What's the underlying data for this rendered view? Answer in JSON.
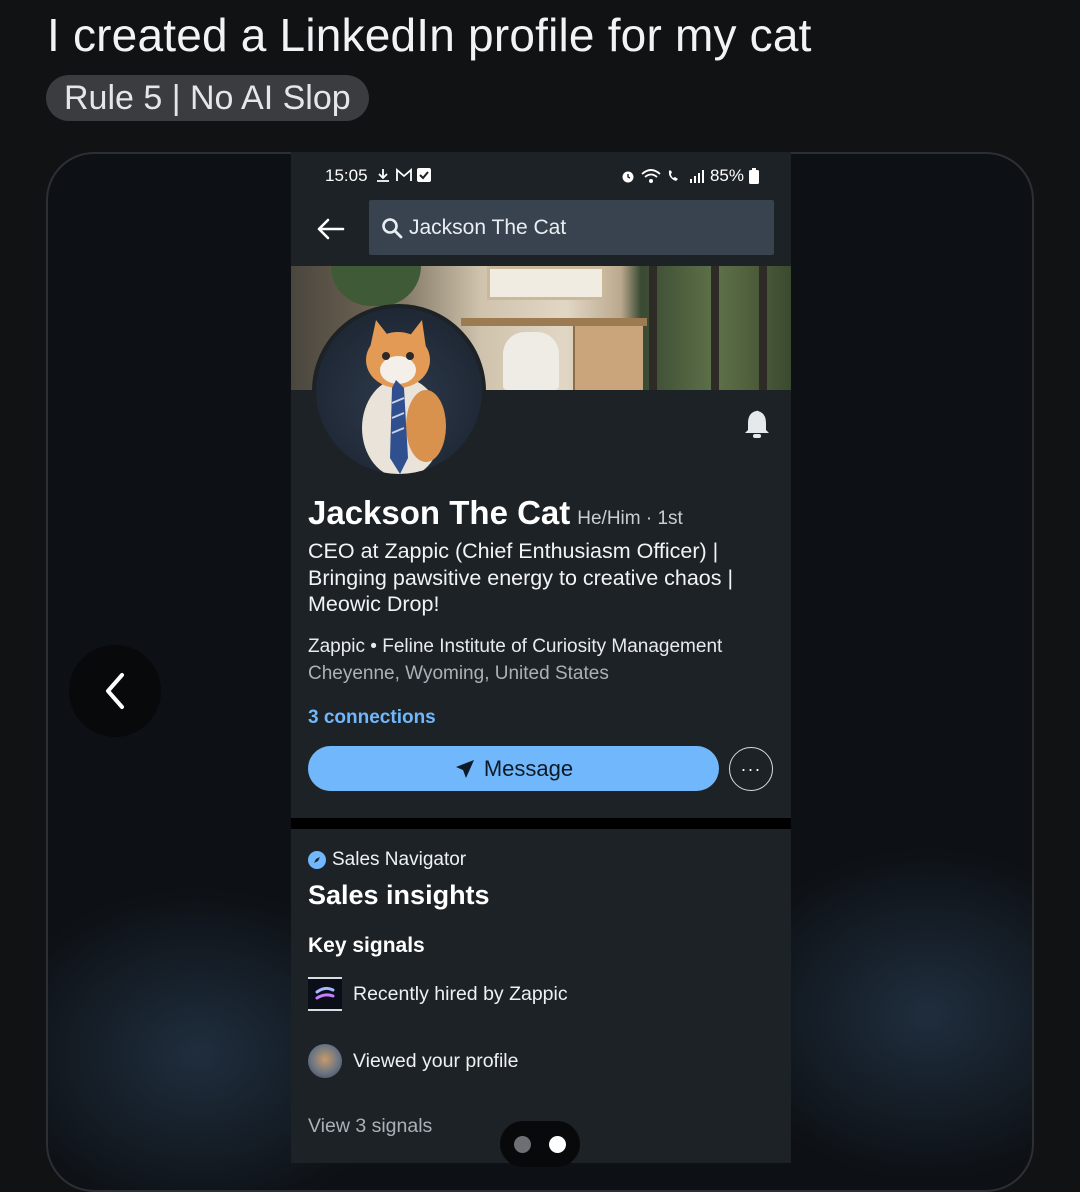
{
  "post": {
    "title": "I created a LinkedIn profile for my cat",
    "flair": "Rule 5 | No AI Slop"
  },
  "status_bar": {
    "time": "15:05",
    "battery": "85%",
    "left_icons": [
      "download-icon",
      "gmail-icon",
      "checkbox-icon"
    ],
    "right_icons": [
      "alarm-icon",
      "wifi-icon",
      "wifi-calling-icon",
      "signal-bars-icon",
      "battery-icon"
    ]
  },
  "search": {
    "query": "Jackson The Cat"
  },
  "profile": {
    "name": "Jackson The Cat",
    "meta": "He/Him · 1st",
    "headline": "CEO at Zappic (Chief Enthusiasm Officer) | Bringing pawsitive energy to creative chaos | Meowic Drop!",
    "org_line": "Zappic • Feline Institute of Curiosity Management",
    "location": "Cheyenne, Wyoming, United States",
    "connections": "3 connections",
    "message_label": "Message",
    "more_label": "···"
  },
  "sales": {
    "navigator_label": "Sales Navigator",
    "title": "Sales insights",
    "key_signals_title": "Key signals",
    "signals": [
      {
        "text": "Recently hired by Zappic",
        "icon": "zappic-logo"
      },
      {
        "text": "Viewed your profile",
        "icon": "cat-avatar"
      }
    ],
    "view_signals": "View 3 signals"
  },
  "gallery": {
    "current_index": 2,
    "total": 2
  },
  "colors": {
    "background": "#111214",
    "linkedin_surface": "#1d2226",
    "accent_blue": "#71b7fb",
    "search_bg": "#38434f"
  }
}
